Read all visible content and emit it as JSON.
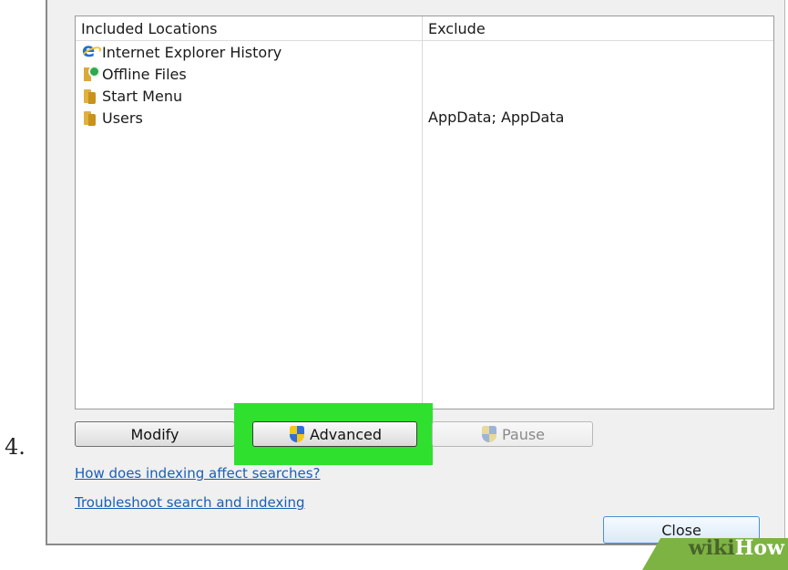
{
  "step_number": "4.",
  "locations_table": {
    "headers": {
      "included": "Included Locations",
      "exclude": "Exclude"
    },
    "rows": [
      {
        "name": "Internet Explorer History",
        "icon": "internet-explorer-icon",
        "exclude": ""
      },
      {
        "name": "Offline Files",
        "icon": "offline-files-icon",
        "exclude": ""
      },
      {
        "name": "Start Menu",
        "icon": "folder-icon",
        "exclude": ""
      },
      {
        "name": "Users",
        "icon": "folder-icon",
        "exclude": "AppData; AppData"
      }
    ]
  },
  "buttons": {
    "modify": "Modify",
    "advanced": "Advanced",
    "pause": "Pause",
    "close": "Close"
  },
  "links": {
    "indexing_help": "How does indexing affect searches?",
    "troubleshoot": "Troubleshoot search and indexing"
  },
  "highlight_color": "#2fe02f",
  "watermark": {
    "text": "wikiHow",
    "color": "#7cb342"
  }
}
